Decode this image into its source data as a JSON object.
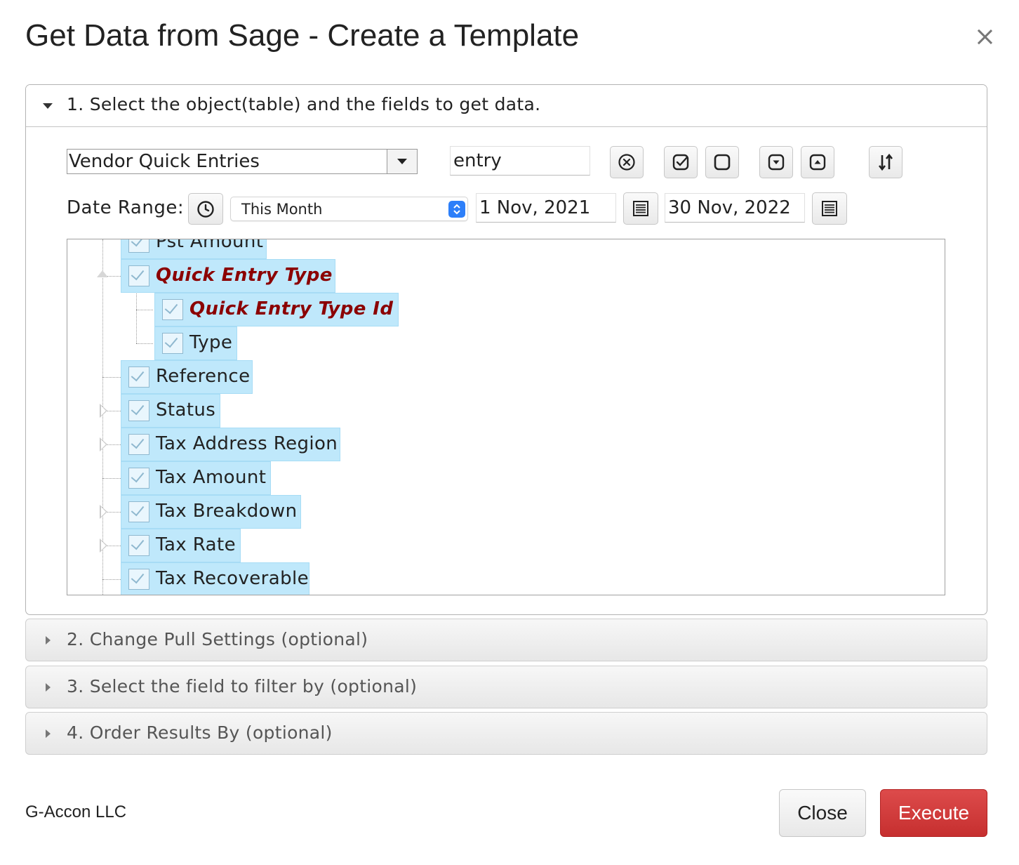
{
  "dialog": {
    "title": "Get Data from Sage - Create a Template",
    "close_icon": "close-icon"
  },
  "section1": {
    "title": "1. Select the object(table) and the fields to get data.",
    "object_select": {
      "value": "Vendor Quick Entries"
    },
    "search": {
      "value": "entry"
    },
    "toolbar_icons": [
      "clear-icon",
      "check-all-icon",
      "uncheck-all-icon",
      "expand-all-icon",
      "collapse-all-icon",
      "sort-icon"
    ],
    "date_range": {
      "label": "Date Range:",
      "clock_icon": "clock-icon",
      "period": "This Month",
      "start": "1 Nov, 2021",
      "end": "30 Nov, 2022",
      "calendar_icon": "calendar-icon"
    },
    "tree": [
      {
        "label": "Pst Amount",
        "key": false,
        "checked": true
      },
      {
        "label": "Quick Entry Type",
        "key": true,
        "checked": true,
        "expanded": true
      },
      {
        "label": "Quick Entry Type Id",
        "key": true,
        "checked": true
      },
      {
        "label": "Type",
        "key": false,
        "checked": true
      },
      {
        "label": "Reference",
        "key": false,
        "checked": true
      },
      {
        "label": "Status",
        "key": false,
        "checked": true,
        "expandable": true
      },
      {
        "label": "Tax Address Region",
        "key": false,
        "checked": true,
        "expandable": true
      },
      {
        "label": "Tax Amount",
        "key": false,
        "checked": true
      },
      {
        "label": "Tax Breakdown",
        "key": false,
        "checked": true,
        "expandable": true
      },
      {
        "label": "Tax Rate",
        "key": false,
        "checked": true,
        "expandable": true
      },
      {
        "label": "Tax Recoverable",
        "key": false,
        "checked": true
      }
    ]
  },
  "section2": {
    "title": "2. Change Pull Settings (optional)"
  },
  "section3": {
    "title": "3. Select the field to filter by (optional)"
  },
  "section4": {
    "title": "4. Order Results By (optional)"
  },
  "footer": {
    "brand": "G-Accon LLC",
    "close_label": "Close",
    "execute_label": "Execute"
  },
  "colors": {
    "execute": "#d23c3c",
    "tree_node_bg": "#bfe8fb",
    "key_field": "#8b0000",
    "accent": "#2d7ff9"
  }
}
